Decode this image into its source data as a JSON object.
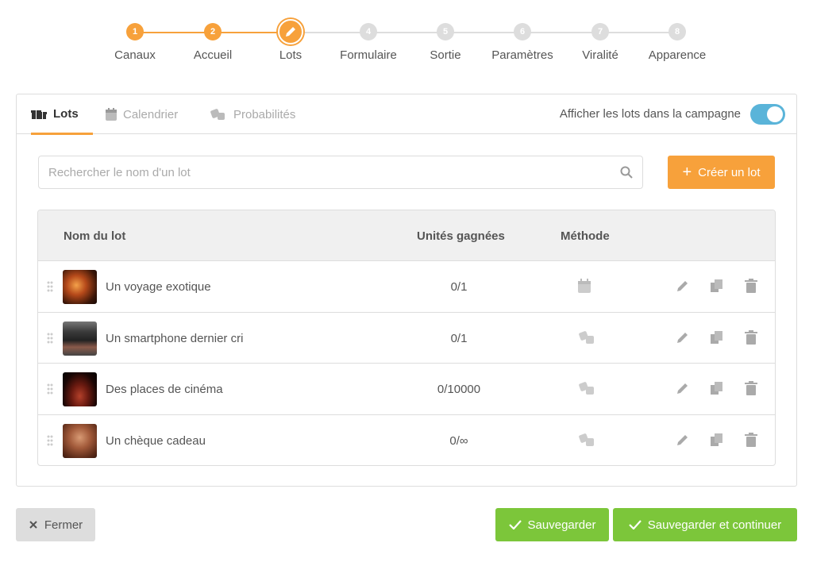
{
  "stepper": {
    "steps": [
      {
        "number": "1",
        "label": "Canaux",
        "state": "done"
      },
      {
        "number": "2",
        "label": "Accueil",
        "state": "done"
      },
      {
        "number": "3",
        "label": "Lots",
        "state": "current"
      },
      {
        "number": "4",
        "label": "Formulaire",
        "state": "pending"
      },
      {
        "number": "5",
        "label": "Sortie",
        "state": "pending"
      },
      {
        "number": "6",
        "label": "Paramètres",
        "state": "pending"
      },
      {
        "number": "7",
        "label": "Viralité",
        "state": "pending"
      },
      {
        "number": "8",
        "label": "Apparence",
        "state": "pending"
      }
    ],
    "current_icon": "pencil-icon"
  },
  "tabs": [
    {
      "label": "Lots",
      "icon": "gifts-icon",
      "active": true
    },
    {
      "label": "Calendrier",
      "icon": "calendar-icon",
      "active": false
    },
    {
      "label": "Probabilités",
      "icon": "dice-icon",
      "active": false
    }
  ],
  "toggle": {
    "label": "Afficher les lots dans la campagne",
    "on": true
  },
  "search": {
    "placeholder": "Rechercher le nom d'un lot",
    "value": ""
  },
  "create_button": {
    "label": "Créer un lot"
  },
  "table": {
    "headers": {
      "name": "Nom du lot",
      "units": "Unités gagnées",
      "method": "Méthode"
    },
    "rows": [
      {
        "name": "Un voyage exotique",
        "units": "0/1",
        "method": "calendar-icon"
      },
      {
        "name": "Un smartphone dernier cri",
        "units": "0/1",
        "method": "dice-icon"
      },
      {
        "name": "Des places de cinéma",
        "units": "0/10000",
        "method": "dice-icon"
      },
      {
        "name": "Un chèque cadeau",
        "units": "0/∞",
        "method": "dice-icon"
      }
    ]
  },
  "buttons": {
    "close": "Fermer",
    "save": "Sauvegarder",
    "save_continue": "Sauvegarder et continuer"
  },
  "colors": {
    "accent": "#f7a13b",
    "success": "#7cc63a",
    "toggle": "#5ab4d9",
    "inactive": "#dddddd"
  }
}
